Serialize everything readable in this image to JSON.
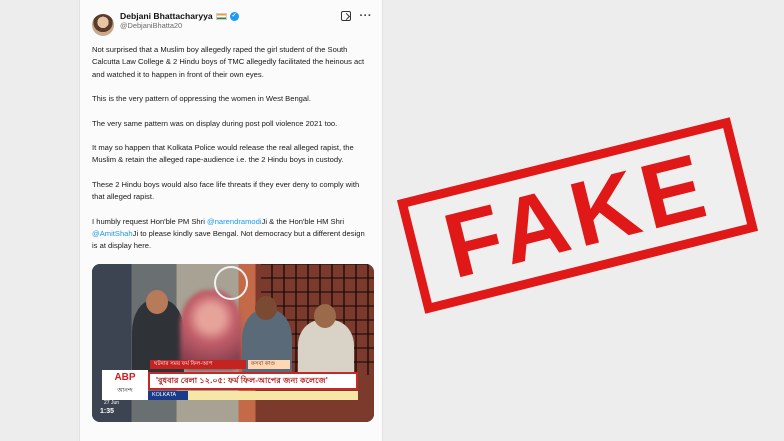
{
  "tweet": {
    "display_name": "Debjani Bhattacharyya",
    "handle": "@DebjaniBhatta20",
    "paragraphs": {
      "p1": "Not surprised that a Muslim boy allegedly raped the girl student of the South Calcutta Law College & 2 Hindu boys of TMC allegedly facilitated the heinous act and watched it to happen in front of their own eyes.",
      "p2": "This is the very pattern of oppressing the women in West Bengal.",
      "p3": "The very same pattern was on display during post poll violence 2021 too.",
      "p4": "It may so happen that Kolkata Police would release the real alleged rapist, the Muslim & retain the alleged rape-audience i.e. the 2 Hindu boys in custody.",
      "p5": "These 2 Hindu boys would also face life threats if they ever deny to comply with that alleged rapist.",
      "p6_a": "I humbly request Hon'ble PM Shri ",
      "p6_mention1": "@narendramodi",
      "p6_b": "Ji & the Hon'ble HM Shri ",
      "p6_mention2": "@AmitShah",
      "p6_c": "Ji to please kindly save Bengal. Not democracy but a different design is at display here."
    },
    "icons": [
      "verified-badge",
      "india-flag",
      "grok-icon",
      "more-icon"
    ]
  },
  "video": {
    "channel": "ABP",
    "channel_sub": "আনন্দ",
    "headline": "'বুধবার বেলা ১২.০৫: ফর্ম ফিল-আপের জন্য কলেজে'",
    "location": "KOLKATA",
    "date_tag": "27 Jun",
    "duration": "1:35",
    "ticker_small": "ঘটনার সময় ফর্ম ফিল-আপ",
    "ticker_small2": "কসবা কাণ্ড"
  },
  "stamp": {
    "text": "FAKE",
    "color": "#e01818"
  }
}
